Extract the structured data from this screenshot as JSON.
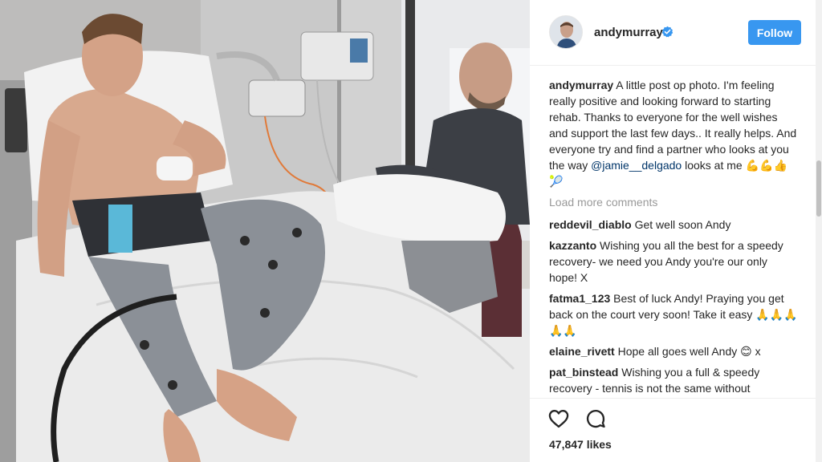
{
  "post": {
    "username": "andymurray",
    "follow_label": "Follow",
    "caption_user": "andymurray",
    "caption_text_1": " A little post op photo. I'm feeling really positive and looking forward to starting rehab. Thanks to everyone for the well wishes and support the last few days.. It really helps. And everyone try and find a partner who looks at you the way ",
    "caption_mention": "@jamie__delgado",
    "caption_text_2": " looks at me 💪💪👍🎾",
    "load_more": "Load more comments",
    "likes": "47,847 likes"
  },
  "comments": [
    {
      "user": "reddevil_diablo",
      "text": " Get well soon Andy"
    },
    {
      "user": "kazzanto",
      "text": " Wishing you all the best for a speedy recovery- we need you Andy you're our only hope! X"
    },
    {
      "user": "fatma1_123",
      "text": " Best of luck Andy! Praying you get back on the court very soon! Take it easy 🙏🙏🙏🙏🙏"
    },
    {
      "user": "elaine_rivett",
      "text": " Hope all goes well Andy 😊 x"
    },
    {
      "user": "pat_binstead",
      "text": " Wishing you a full & speedy recovery - tennis is not the same without"
    }
  ],
  "colors": {
    "follow_button": "#3897f0",
    "verified_badge": "#3897f0",
    "mention": "#003569",
    "muted": "#999999"
  },
  "icons": {
    "like": "heart-icon",
    "comment": "comment-icon",
    "verified": "verified-badge-icon"
  }
}
